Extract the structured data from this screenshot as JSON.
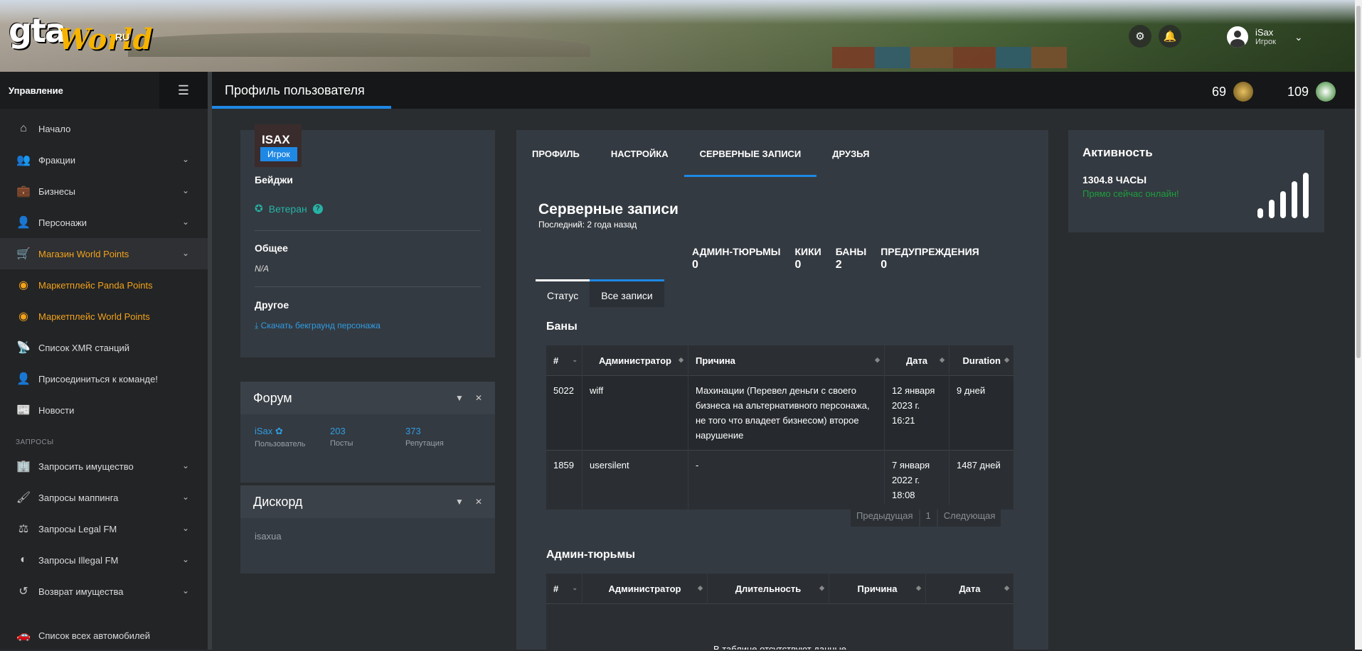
{
  "header": {
    "logo": {
      "main": "gta",
      "script": "World",
      "suffix": "RU"
    },
    "user": {
      "name": "iSax",
      "role": "Игрок"
    },
    "icons": [
      "gear-icon",
      "bell-icon"
    ]
  },
  "sidebar": {
    "title": "Управление",
    "items": [
      {
        "label": "Начало",
        "icon": "home-icon"
      },
      {
        "label": "Фракции",
        "icon": "users-icon"
      },
      {
        "label": "Бизнесы",
        "icon": "briefcase-icon"
      },
      {
        "label": "Персонажи",
        "icon": "user-icon"
      },
      {
        "label": "Магазин World Points",
        "icon": "cart-icon"
      },
      {
        "label": "Маркетплейс Panda Points",
        "icon": "coins-icon"
      },
      {
        "label": "Маркетплейс World Points",
        "icon": "coins-icon"
      },
      {
        "label": "Список XMR станций",
        "icon": "antenna-icon"
      },
      {
        "label": "Присоединиться к команде!",
        "icon": "user-tie-icon"
      },
      {
        "label": "Новости",
        "icon": "newspaper-icon"
      }
    ],
    "section_label": "ЗАПРОСЫ",
    "requests": [
      {
        "label": "Запросить имущество",
        "icon": "building-icon"
      },
      {
        "label": "Запросы маппинга",
        "icon": "brush-icon"
      },
      {
        "label": "Запросы Legal FM",
        "icon": "scale-icon"
      },
      {
        "label": "Запросы Illegal FM",
        "icon": "mask-icon"
      },
      {
        "label": "Возврат имущества",
        "icon": "undo-icon"
      },
      {
        "label": "Список всех автомобилей",
        "icon": "car-icon"
      }
    ]
  },
  "titlebar": {
    "title": "Профиль пользователя",
    "stat1": "69",
    "stat2": "109"
  },
  "profile": {
    "name": "ISAX",
    "role": "Игрок",
    "badges_label": "Бейджи",
    "badge": "Ветеран",
    "general_label": "Общее",
    "general_value": "N/A",
    "other_label": "Другое",
    "download_link": "Скачать бекграунд персонажа"
  },
  "forum": {
    "title": "Форум",
    "user": "iSax",
    "user_label": "Пользователь",
    "posts": "203",
    "posts_label": "Посты",
    "rep": "373",
    "rep_label": "Репутация"
  },
  "discord": {
    "title": "Дискорд",
    "value": "isaxua"
  },
  "main": {
    "tabs": [
      "ПРОФИЛЬ",
      "НАСТРОЙКА",
      "СЕРВЕРНЫЕ ЗАПИСИ",
      "ДРУЗЬЯ"
    ],
    "title": "Серверные записи",
    "subtitle": "Последний: 2 года назад",
    "counters": [
      {
        "label": "АДМИН-ТЮРЬМЫ",
        "value": "0"
      },
      {
        "label": "КИКИ",
        "value": "0"
      },
      {
        "label": "БАНЫ",
        "value": "2"
      },
      {
        "label": "ПРЕДУПРЕЖДЕНИЯ",
        "value": "0"
      }
    ],
    "subtabs": [
      "Статус",
      "Все записи"
    ],
    "bans_title": "Баны",
    "bans_headers": [
      "#",
      "Администратор",
      "Причина",
      "Дата",
      "Duration"
    ],
    "bans_rows": [
      [
        "5022",
        "wiff",
        "Махинации (Перевел деньги с своего бизнеса на альтернативного персонажа, не того что владеет бизнесом) второе нарушение",
        "12 января 2023 г. 16:21",
        "9 дней"
      ],
      [
        "1859",
        "usersilent",
        "-",
        "7 января 2022 г. 18:08",
        "1487 дней"
      ]
    ],
    "pager": {
      "prev": "Предыдущая",
      "page": "1",
      "next": "Следующая"
    },
    "jail_title": "Админ-тюрьмы",
    "jail_headers": [
      "#",
      "Администратор",
      "Длительность",
      "Причина",
      "Дата"
    ],
    "empty": "В таблице отсутствуют данные"
  },
  "activity": {
    "title": "Активность",
    "hours": "1304.8 ЧАСЫ",
    "online": "Прямо сейчас онлайн!"
  },
  "colors": {
    "accent": "#1e88e5",
    "orange": "#f3a21a",
    "teal": "#26b3a6",
    "online": "#1e9e3e"
  }
}
